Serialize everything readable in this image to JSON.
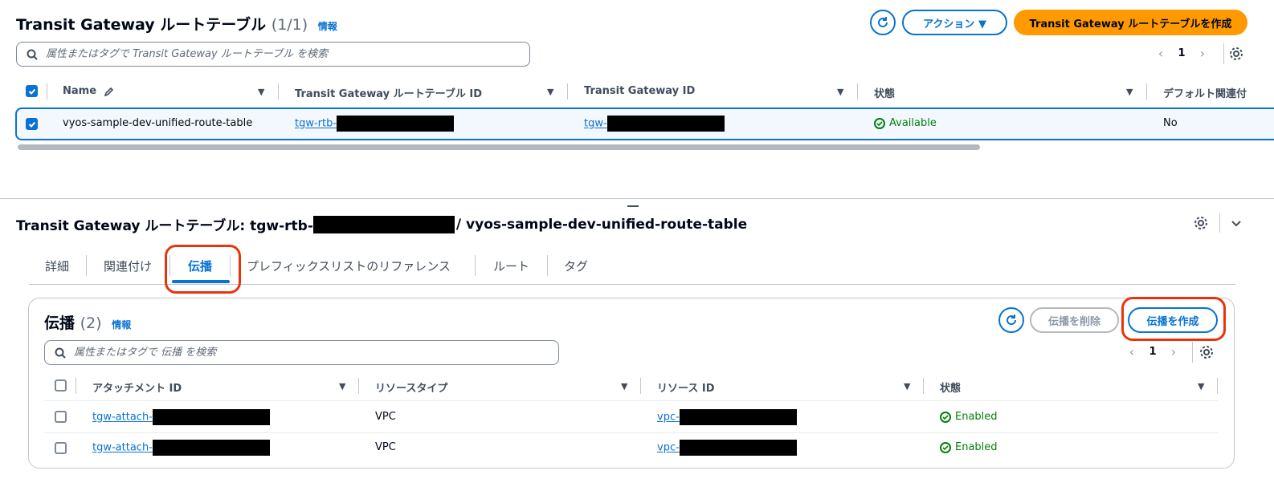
{
  "top": {
    "title": "Transit Gateway ルートテーブル",
    "count": "(1/1)",
    "info": "情報",
    "actions_label": "アクション ▼",
    "create_label": "Transit Gateway ルートテーブルを作成",
    "search_placeholder": "属性またはタグで Transit Gateway ルートテーブル を検索",
    "page": "1",
    "columns": [
      "Name",
      "Transit Gateway ルートテーブル ID",
      "Transit Gateway ID",
      "状態",
      "デフォルト関連付"
    ],
    "row": {
      "name": "vyos-sample-dev-unified-route-table",
      "rtb_id_prefix": "tgw-rtb-",
      "tgw_id_prefix": "tgw-",
      "state": "Available",
      "default_assoc": "No"
    }
  },
  "detail": {
    "title_prefix": "Transit Gateway ルートテーブル: tgw-rtb-",
    "title_suffix": "/ vyos-sample-dev-unified-route-table",
    "tabs": [
      "詳細",
      "関連付け",
      "伝播",
      "プレフィックスリストのリファレンス",
      "ルート",
      "タグ"
    ]
  },
  "propagation": {
    "title": "伝播",
    "count": "(2)",
    "info": "情報",
    "delete_label": "伝播を削除",
    "create_label": "伝播を作成",
    "search_placeholder": "属性またはタグで 伝播 を検索",
    "page": "1",
    "columns": [
      "アタッチメント ID",
      "リソースタイプ",
      "リソース ID",
      "状態"
    ],
    "rows": [
      {
        "attach_prefix": "tgw-attach-",
        "type": "VPC",
        "resource_prefix": "vpc-",
        "state": "Enabled"
      },
      {
        "attach_prefix": "tgw-attach-",
        "type": "VPC",
        "resource_prefix": "vpc-",
        "state": "Enabled"
      }
    ]
  },
  "colors": {
    "accent": "#0972d3",
    "primary": "#ff9900",
    "success": "#037f0c",
    "highlight": "#e8340c"
  }
}
